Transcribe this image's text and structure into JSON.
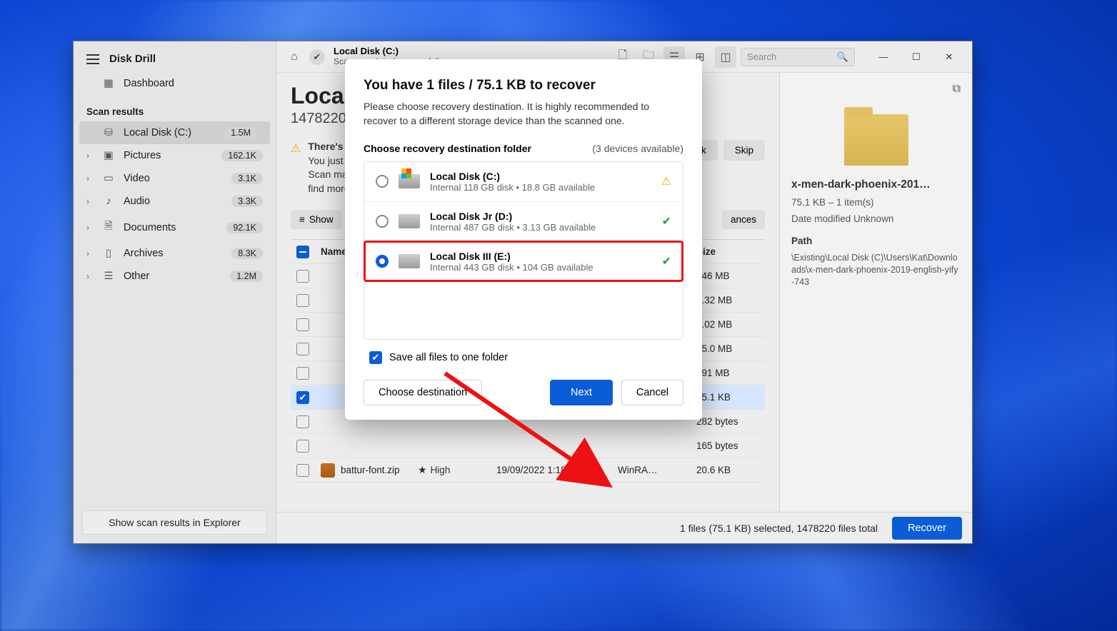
{
  "app": {
    "title": "Disk Drill"
  },
  "sidebar": {
    "dashboard": "Dashboard",
    "scan_results_label": "Scan results",
    "items": [
      {
        "label": "Local Disk (C:)",
        "count": "1.5M",
        "selected": true,
        "icon": "disk"
      },
      {
        "label": "Pictures",
        "count": "162.1K",
        "icon": "image"
      },
      {
        "label": "Video",
        "count": "3.1K",
        "icon": "video"
      },
      {
        "label": "Audio",
        "count": "3.3K",
        "icon": "audio"
      },
      {
        "label": "Documents",
        "count": "92.1K",
        "icon": "document"
      },
      {
        "label": "Archives",
        "count": "8.3K",
        "icon": "archive"
      },
      {
        "label": "Other",
        "count": "1.2M",
        "icon": "other"
      }
    ],
    "footer_link": "Show scan results in Explorer"
  },
  "toolbar": {
    "location_title": "Local Disk (C:)",
    "location_status": "Scan completed successfully",
    "search_placeholder": "Search"
  },
  "page": {
    "title": "Local",
    "subtitle": "1478220",
    "alert_title": "There's",
    "alert_body": "You just successfully completed a Quick Scan. A more thorough Deep Scan may take a long time, but there's a good chance Disk Drill could find more files. It may be worth it.",
    "scan_btn": "Scan entire disk",
    "skip_btn": "Skip",
    "show_filter": "Show",
    "chances_filter": "ances",
    "col_name": "Name",
    "col_size": "Size"
  },
  "rows": [
    {
      "name": "",
      "size": "346 MB",
      "selected": false
    },
    {
      "name": "",
      "size": "9.32 MB",
      "selected": false
    },
    {
      "name": "",
      "size": "9.02 MB",
      "selected": false
    },
    {
      "name": "",
      "size": "55.0 MB",
      "selected": false
    },
    {
      "name": "",
      "size": "491 MB",
      "selected": false
    },
    {
      "name": "",
      "size": "75.1 KB",
      "selected": true
    },
    {
      "name": "",
      "size": "282 bytes",
      "selected": false
    },
    {
      "name": "",
      "size": "165 bytes",
      "selected": false
    },
    {
      "name": "battur-font.zip",
      "recov": "High",
      "date": "19/09/2022 1:18…",
      "type": "WinRA…",
      "size": "20.6 KB",
      "selected": false
    }
  ],
  "preview": {
    "name": "x-men-dark-phoenix-201…",
    "meta": "75.1 KB – 1 item(s)",
    "modified": "Date modified Unknown",
    "path_label": "Path",
    "path": "\\Existing\\Local Disk (C)\\Users\\Kat\\Downloads\\x-men-dark-phoenix-2019-english-yify-743"
  },
  "footer": {
    "status": "1 files (75.1 KB) selected, 1478220 files total",
    "recover_btn": "Recover"
  },
  "modal": {
    "title": "You have 1 files / 75.1 KB to recover",
    "desc": "Please choose recovery destination. It is highly recommended to recover to a different storage device than the scanned one.",
    "choose_label": "Choose recovery destination folder",
    "devices_label": "(3 devices available)",
    "destinations": [
      {
        "name": "Local Disk (C:)",
        "meta": "Internal 118 GB disk • 18.8 GB available",
        "status": "warn",
        "win": true,
        "selected": false
      },
      {
        "name": "Local Disk Jr (D:)",
        "meta": "Internal 487 GB disk • 3.13 GB available",
        "status": "ok",
        "win": false,
        "selected": false
      },
      {
        "name": "Local Disk III (E:)",
        "meta": "Internal 443 GB disk • 104 GB available",
        "status": "ok",
        "win": false,
        "selected": true,
        "highlight": true
      }
    ],
    "save_all_label": "Save all files to one folder",
    "choose_dest_btn": "Choose destination",
    "next_btn": "Next",
    "cancel_btn": "Cancel"
  }
}
